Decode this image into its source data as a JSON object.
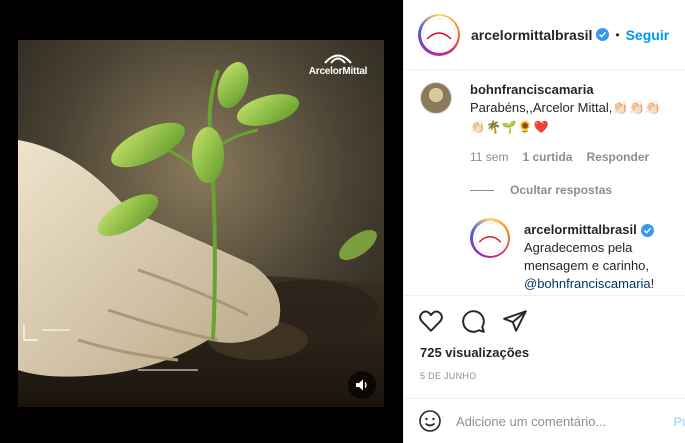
{
  "post": {
    "video_brand": "ArcelorMittal"
  },
  "header": {
    "username": "arcelormittalbrasil",
    "separator": "•",
    "follow_label": "Seguir"
  },
  "comments": [
    {
      "username": "bohnfranciscamaria",
      "text": "Parabéns,,Arcelor Mittal,👏🏻👏🏻👏🏻",
      "emoji_line": "👏🏻🌴🌱🌻❤️",
      "age": "11 sem",
      "likes": "1 curtida",
      "reply_label": "Responder",
      "hide_replies_label": "Ocultar respostas"
    }
  ],
  "reply": {
    "username": "arcelormittalbrasil",
    "text": "Agradecemos pela mensagem e carinho,",
    "mention": "@bohnfranciscamaria",
    "end": "!"
  },
  "stats": {
    "views": "725 visualizações",
    "date": "5 DE JUNHO"
  },
  "composer": {
    "placeholder": "Adicione um comentário...",
    "publish_label": "Pu"
  },
  "colors": {
    "accent": "#0095f6",
    "verified": "#3897f0",
    "muted": "#8e8e8e",
    "mention": "#00376b"
  },
  "icons": [
    "heart-icon",
    "comment-icon",
    "share-icon",
    "smiley-icon",
    "volume-icon",
    "verified-icon"
  ]
}
